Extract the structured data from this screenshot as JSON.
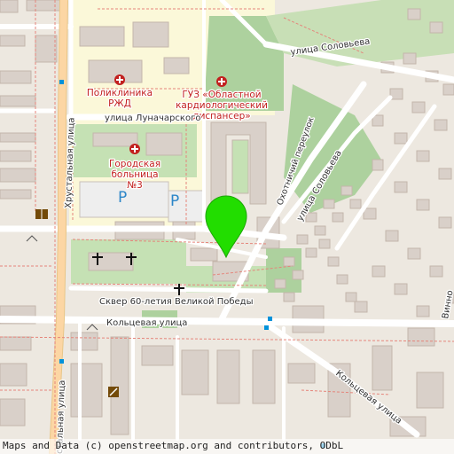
{
  "map": {
    "streets": {
      "lunacharskogo": "улица Луначарского",
      "solovyeva_top": "улица Соловьева",
      "solovyeva_diag": "улица Соловьева",
      "okhotnichiy": "Охотничий переулок",
      "khrustalnaya": "Хрустальная улица",
      "khrustalnaya_bottom": "стальная улица",
      "koltsevaya_h": "Кольцевая улица",
      "koltsevaya_diag": "Кольцевая улица",
      "skver": "Сквер 60-летия Великой Победы",
      "vinno": "Винно"
    },
    "pois": {
      "poliklinika": [
        "Поликлиника",
        "РЖД"
      ],
      "cardio": [
        "ГУЗ «Областной",
        "кардиологический",
        "диспансер»"
      ],
      "hospital": [
        "Городская",
        "больница",
        "№3"
      ]
    },
    "parking_label": "P",
    "attribution": "Maps and Data (c) openstreetmap.org and contributors, ODbL"
  },
  "colors": {
    "background": "#ede8e0",
    "building": "#d9d0c9",
    "green": "#add19e",
    "hospital_area": "#fbf8d9",
    "parking": "#eeeeee",
    "road": "#ffffff",
    "primary_road": "#fcd6a4",
    "marker": "#22dd00",
    "poi_text": "#c2201f",
    "parking_text": "#2c86c8"
  }
}
